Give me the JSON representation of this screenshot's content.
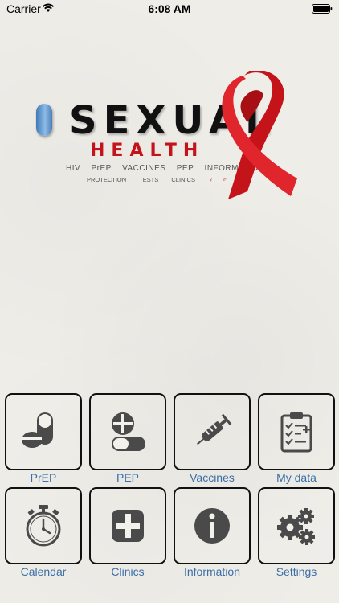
{
  "status_bar": {
    "carrier": "Carrier",
    "time": "6:08 AM"
  },
  "logo": {
    "title": "SEXUAL",
    "subtitle": "HEALTH",
    "tags": [
      "HIV",
      "PrEP",
      "VACCINES",
      "PEP",
      "INFORMATION"
    ],
    "subtags": [
      "PROTECTION",
      "TESTS",
      "CLINICS"
    ],
    "gender_symbols": "♀ ♂ ⚥"
  },
  "menu": [
    {
      "label": "PrEP",
      "icon": "pills-icon"
    },
    {
      "label": "PEP",
      "icon": "pill-capsule-icon"
    },
    {
      "label": "Vaccines",
      "icon": "syringe-icon"
    },
    {
      "label": "My data",
      "icon": "clipboard-icon"
    },
    {
      "label": "Calendar",
      "icon": "stopwatch-icon"
    },
    {
      "label": "Clinics",
      "icon": "medical-cross-icon"
    },
    {
      "label": "Information",
      "icon": "info-icon"
    },
    {
      "label": "Settings",
      "icon": "gears-icon"
    }
  ],
  "colors": {
    "label": "#3a6fa8",
    "icon": "#4a4a4a",
    "ribbon": "#c4141a"
  }
}
